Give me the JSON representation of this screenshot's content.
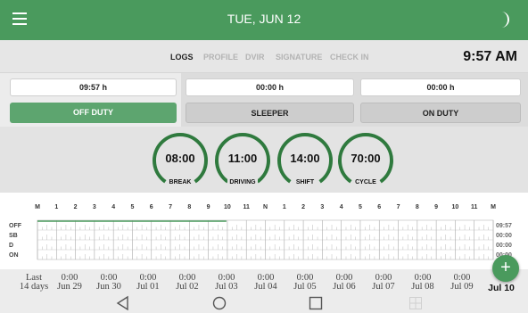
{
  "header": {
    "menu_icon": "hamburger-menu-icon",
    "title": "TUE, JUN 12",
    "theme_icon": "moon-icon"
  },
  "tabs": [
    {
      "label": "LOGS",
      "active": true
    },
    {
      "label": "PROFILE",
      "active": false
    },
    {
      "label": "DVIR",
      "active": false
    },
    {
      "label": "SIGNATURE",
      "active": false
    },
    {
      "label": "CHECK IN",
      "active": false
    }
  ],
  "clock": "9:57 AM",
  "durations": [
    "09:57 h",
    "00:00 h",
    "00:00 h"
  ],
  "status_buttons": [
    {
      "label": "OFF DUTY",
      "active": true
    },
    {
      "label": "SLEEPER",
      "active": false
    },
    {
      "label": "ON DUTY",
      "active": false
    }
  ],
  "gauges": [
    {
      "value": "08:00",
      "label": "BREAK",
      "fraction": 1.0
    },
    {
      "value": "11:00",
      "label": "DRIVING",
      "fraction": 1.0
    },
    {
      "value": "14:00",
      "label": "SHIFT",
      "fraction": 1.0
    },
    {
      "value": "70:00",
      "label": "CYCLE",
      "fraction": 1.0
    }
  ],
  "log_graph": {
    "hour_labels": [
      "M",
      "1",
      "2",
      "3",
      "4",
      "5",
      "6",
      "7",
      "8",
      "9",
      "10",
      "11",
      "N",
      "1",
      "2",
      "3",
      "4",
      "5",
      "6",
      "7",
      "8",
      "9",
      "10",
      "11",
      "M"
    ],
    "rows": [
      {
        "label": "OFF",
        "total": "09:57"
      },
      {
        "label": "SB",
        "total": "00:00"
      },
      {
        "label": "D",
        "total": "00:00"
      },
      {
        "label": "ON",
        "total": "00:00"
      }
    ],
    "off_duty_hours": 9.95,
    "line_color": "#4a9a5d"
  },
  "days": {
    "first_label_line1": "Last",
    "first_label_line2": "14 days",
    "items": [
      {
        "value": "0:00",
        "date": "Jun 29"
      },
      {
        "value": "0:00",
        "date": "Jun 30"
      },
      {
        "value": "0:00",
        "date": "Jul 01"
      },
      {
        "value": "0:00",
        "date": "Jul 02"
      },
      {
        "value": "0:00",
        "date": "Jul 03"
      },
      {
        "value": "0:00",
        "date": "Jul 04"
      },
      {
        "value": "0:00",
        "date": "Jul 05"
      },
      {
        "value": "0:00",
        "date": "Jul 06"
      },
      {
        "value": "0:00",
        "date": "Jul 07"
      },
      {
        "value": "0:00",
        "date": "Jul 08"
      },
      {
        "value": "0:00",
        "date": "Jul 09"
      }
    ],
    "current": {
      "date": "Jul 10"
    }
  },
  "fab": {
    "label": "+",
    "icon": "plus-icon"
  },
  "navbar": [
    "back-icon",
    "home-icon",
    "recents-icon",
    "grid-icon"
  ],
  "colors": {
    "brand": "#4a9a5d",
    "active_status": "#5da56f"
  }
}
